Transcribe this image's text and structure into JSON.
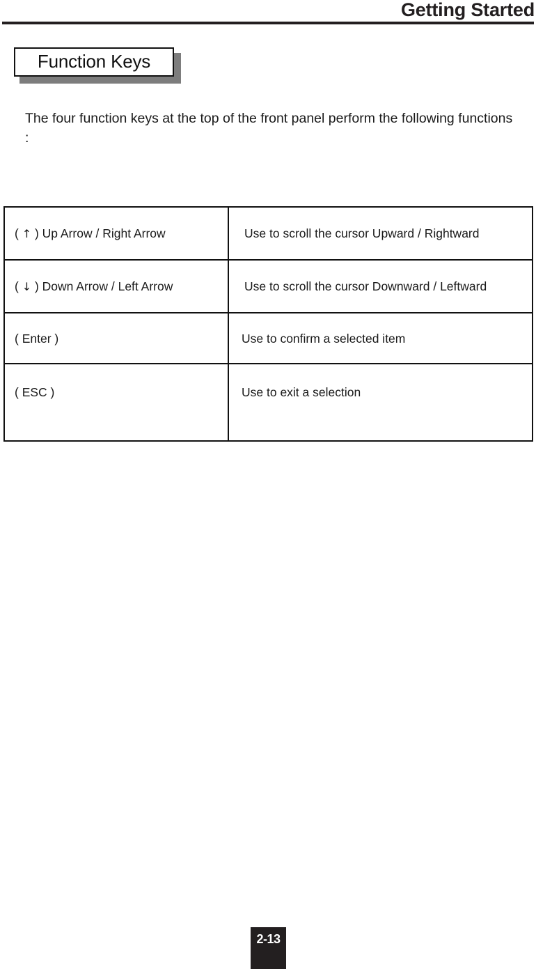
{
  "header": {
    "title": "Getting Started"
  },
  "section": {
    "title": "Function Keys"
  },
  "intro": {
    "text": "The four function keys at the top of the front panel perform the following functions :"
  },
  "key_table": {
    "rows": [
      {
        "key": "( ↑ ) Up Arrow / Right Arrow",
        "key_symbol": "↑",
        "key_text_before": "( ",
        "key_text_after": " ) Up Arrow / Right Arrow",
        "description": "Use to scroll the cursor Upward / Rightward"
      },
      {
        "key": "( ↓ ) Down Arrow / Left Arrow",
        "key_symbol": "↓",
        "key_text_before": "( ",
        "key_text_after": " ) Down Arrow / Left Arrow",
        "description": "Use to scroll the cursor Downward / Leftward"
      },
      {
        "key": "( Enter )",
        "key_symbol": "",
        "key_text_before": "( Enter )",
        "key_text_after": "",
        "description": "Use to confirm a selected item"
      },
      {
        "key": "( ESC )",
        "key_symbol": "",
        "key_text_before": "( ESC )",
        "key_text_after": "",
        "description": "Use to exit a selection"
      }
    ]
  },
  "footer": {
    "page_number": "2-13"
  },
  "colors": {
    "ink": "#231f20",
    "rule": "#111111",
    "shadow": "#7d7d7d",
    "folio_background": "#231f20",
    "folio_text": "#ffffff"
  }
}
